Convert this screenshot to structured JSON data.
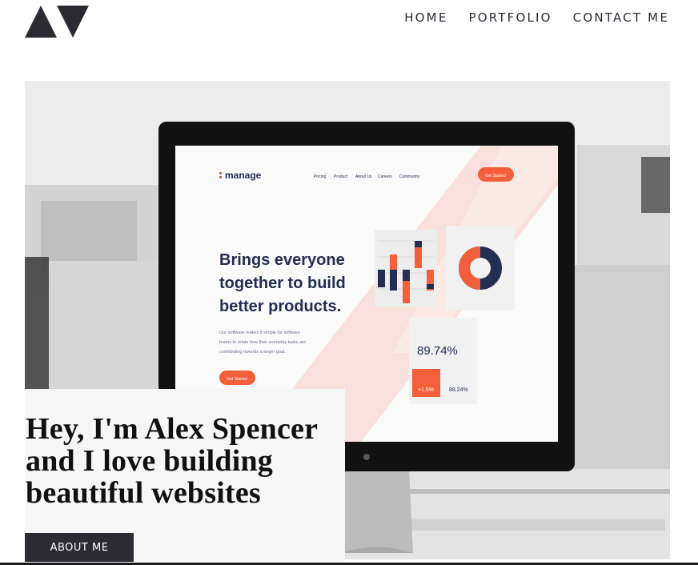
{
  "brand": {
    "logo_icon": "av-triangles-logo",
    "colors": {
      "dark": "#2c2b33",
      "accent": "#f25f3a"
    }
  },
  "nav": {
    "items": [
      {
        "label": "HOME"
      },
      {
        "label": "PORTFOLIO"
      },
      {
        "label": "CONTACT ME"
      }
    ]
  },
  "hero_mockup": {
    "brand": "manage",
    "nav_items": [
      "Pricing",
      "Product",
      "About Us",
      "Careers",
      "Community"
    ],
    "cta_top": "Get Started",
    "headline_lines": [
      "Brings everyone",
      "together to build",
      "better products."
    ],
    "body_lines": [
      "Our software makes it simple for software",
      "teams to relate how their everyday tasks are",
      "contributing towards a larger goal."
    ],
    "cta_bottom": "Get Started",
    "stat_main": "89.74%",
    "stat_change": "+1.5%",
    "stat_small": "88.24%"
  },
  "intro": {
    "heading": "Hey, I'm Alex Spencer and I love building beautiful websites",
    "button_label": "ABOUT ME"
  }
}
